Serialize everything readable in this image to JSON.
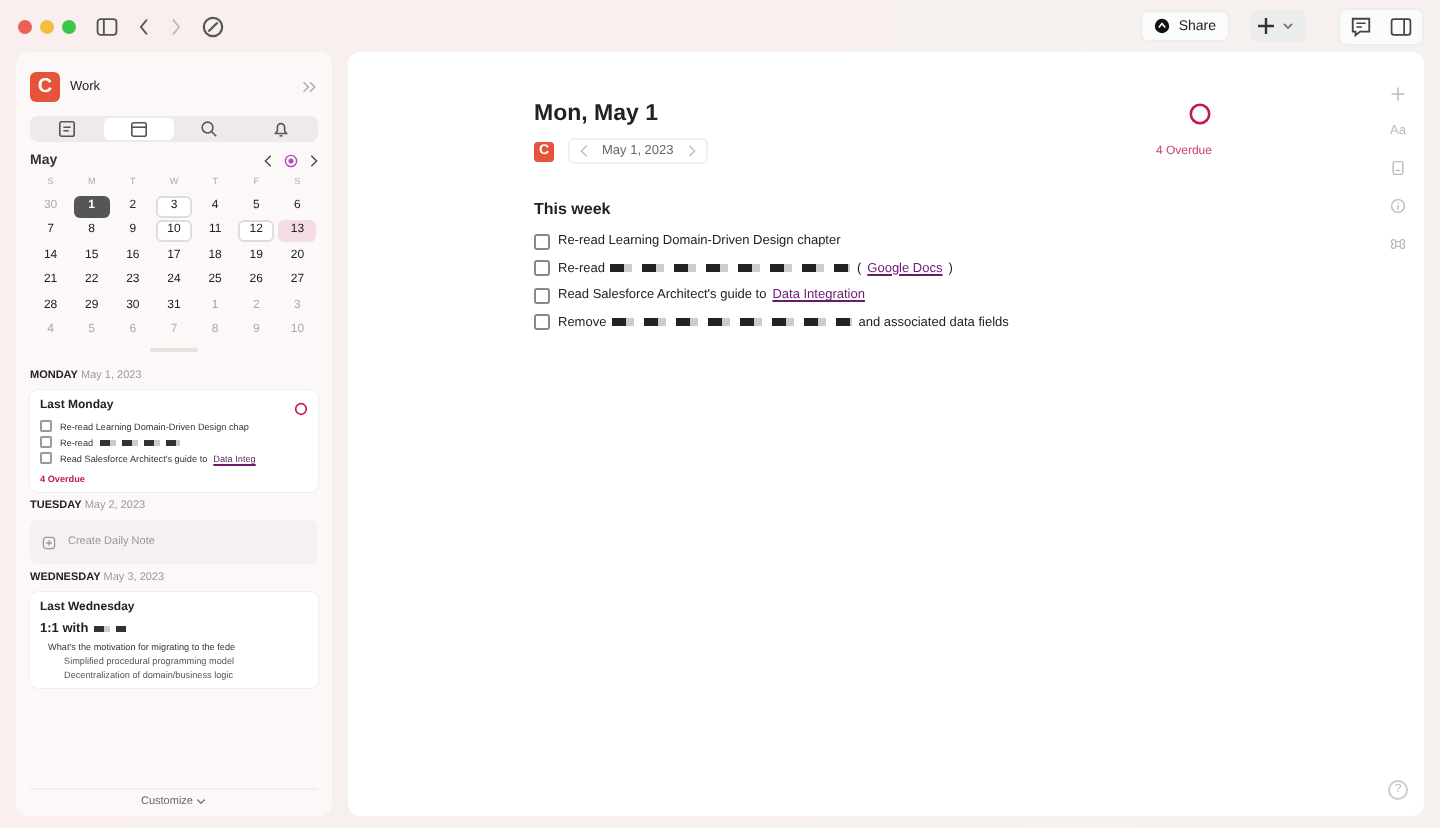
{
  "toolbar": {
    "back_disabled": false,
    "forward_disabled": true,
    "share": "Share"
  },
  "sidebar": {
    "logo": "C",
    "workspace": "Work",
    "tabs": [
      {
        "selected": false
      },
      {
        "selected": true
      },
      {
        "selected": false
      },
      {
        "selected": false
      }
    ],
    "calendar": {
      "month": "May",
      "weekdays": [
        "S",
        "M",
        "T",
        "W",
        "T",
        "F",
        "S"
      ],
      "weeks": [
        [
          {
            "label": "30",
            "kind": "muted"
          },
          {
            "label": "1",
            "kind": "selected"
          },
          {
            "label": "2",
            "kind": "plain"
          },
          {
            "label": "3",
            "kind": "note"
          },
          {
            "label": "4",
            "kind": "plain"
          },
          {
            "label": "5",
            "kind": "plain"
          },
          {
            "label": "6",
            "kind": "plain"
          }
        ],
        [
          {
            "label": "7",
            "kind": "plain"
          },
          {
            "label": "8",
            "kind": "plain"
          },
          {
            "label": "9",
            "kind": "plain"
          },
          {
            "label": "10",
            "kind": "note"
          },
          {
            "label": "11",
            "kind": "plain"
          },
          {
            "label": "12",
            "kind": "note"
          },
          {
            "label": "13",
            "kind": "today"
          }
        ],
        [
          {
            "label": "14",
            "kind": "plain"
          },
          {
            "label": "15",
            "kind": "plain"
          },
          {
            "label": "16",
            "kind": "plain"
          },
          {
            "label": "17",
            "kind": "plain"
          },
          {
            "label": "18",
            "kind": "plain"
          },
          {
            "label": "19",
            "kind": "plain"
          },
          {
            "label": "20",
            "kind": "plain"
          }
        ],
        [
          {
            "label": "21",
            "kind": "plain"
          },
          {
            "label": "22",
            "kind": "plain"
          },
          {
            "label": "23",
            "kind": "plain"
          },
          {
            "label": "24",
            "kind": "plain"
          },
          {
            "label": "25",
            "kind": "plain"
          },
          {
            "label": "26",
            "kind": "plain"
          },
          {
            "label": "27",
            "kind": "plain"
          }
        ],
        [
          {
            "label": "28",
            "kind": "plain"
          },
          {
            "label": "29",
            "kind": "plain"
          },
          {
            "label": "30",
            "kind": "plain"
          },
          {
            "label": "31",
            "kind": "plain"
          },
          {
            "label": "1",
            "kind": "muted"
          },
          {
            "label": "2",
            "kind": "muted"
          },
          {
            "label": "3",
            "kind": "muted"
          }
        ],
        [
          {
            "label": "4",
            "kind": "muted"
          },
          {
            "label": "5",
            "kind": "muted"
          },
          {
            "label": "6",
            "kind": "muted"
          },
          {
            "label": "7",
            "kind": "muted"
          },
          {
            "label": "8",
            "kind": "muted"
          },
          {
            "label": "9",
            "kind": "muted"
          },
          {
            "label": "10",
            "kind": "muted"
          }
        ]
      ]
    },
    "days": [
      {
        "weekday": "MONDAY",
        "date": "May 1, 2023",
        "kind": "note",
        "title": "Last Monday",
        "tasks": [
          {
            "checked": false,
            "segments": [
              {
                "kind": "text",
                "text": "Re-read Learning Domain-Driven Design chap"
              }
            ]
          },
          {
            "checked": false,
            "segments": [
              {
                "kind": "text",
                "text": "Re-read"
              },
              {
                "kind": "redacted"
              }
            ]
          },
          {
            "checked": false,
            "segments": [
              {
                "kind": "text",
                "text": "Read Salesforce Architect's guide to"
              },
              {
                "kind": "link",
                "text": "Data Integ"
              }
            ]
          }
        ],
        "overdue": "4 Overdue"
      },
      {
        "weekday": "TUESDAY",
        "date": "May 2, 2023",
        "kind": "empty",
        "action": "Create Daily Note"
      },
      {
        "weekday": "WEDNESDAY",
        "date": "May 3, 2023",
        "kind": "note",
        "title": "Last Wednesday",
        "heading": "1:1 with",
        "bullets": [
          {
            "text": "What's the motivation for migrating to the fede",
            "children": [
              {
                "text": "Simplified procedural programming model"
              },
              {
                "text": "Decentralization of domain/business logic"
              }
            ]
          }
        ]
      }
    ],
    "footer": "Customize"
  },
  "note": {
    "title": "Mon, May 1",
    "logo": "C",
    "date": "May 1, 2023",
    "overdue": "4 Overdue",
    "section": "This week",
    "tasks": [
      {
        "checked": false,
        "segments": [
          {
            "kind": "text",
            "text": "Re-read Learning Domain-Driven Design chapter"
          }
        ]
      },
      {
        "checked": false,
        "segments": [
          {
            "kind": "text",
            "text": "Re-read"
          },
          {
            "kind": "redacted"
          },
          {
            "kind": "text",
            "text": "("
          },
          {
            "kind": "link",
            "text": "Google Docs"
          },
          {
            "kind": "text",
            "text": ")"
          }
        ]
      },
      {
        "checked": false,
        "segments": [
          {
            "kind": "text",
            "text": "Read Salesforce Architect's guide to"
          },
          {
            "kind": "link",
            "text": "Data Integration"
          }
        ]
      },
      {
        "checked": false,
        "segments": [
          {
            "kind": "text",
            "text": "Remove"
          },
          {
            "kind": "redacted"
          },
          {
            "kind": "text",
            "text": "and associated data fields"
          }
        ]
      }
    ]
  },
  "rail": {
    "text_button": "Aa",
    "help": "?"
  }
}
